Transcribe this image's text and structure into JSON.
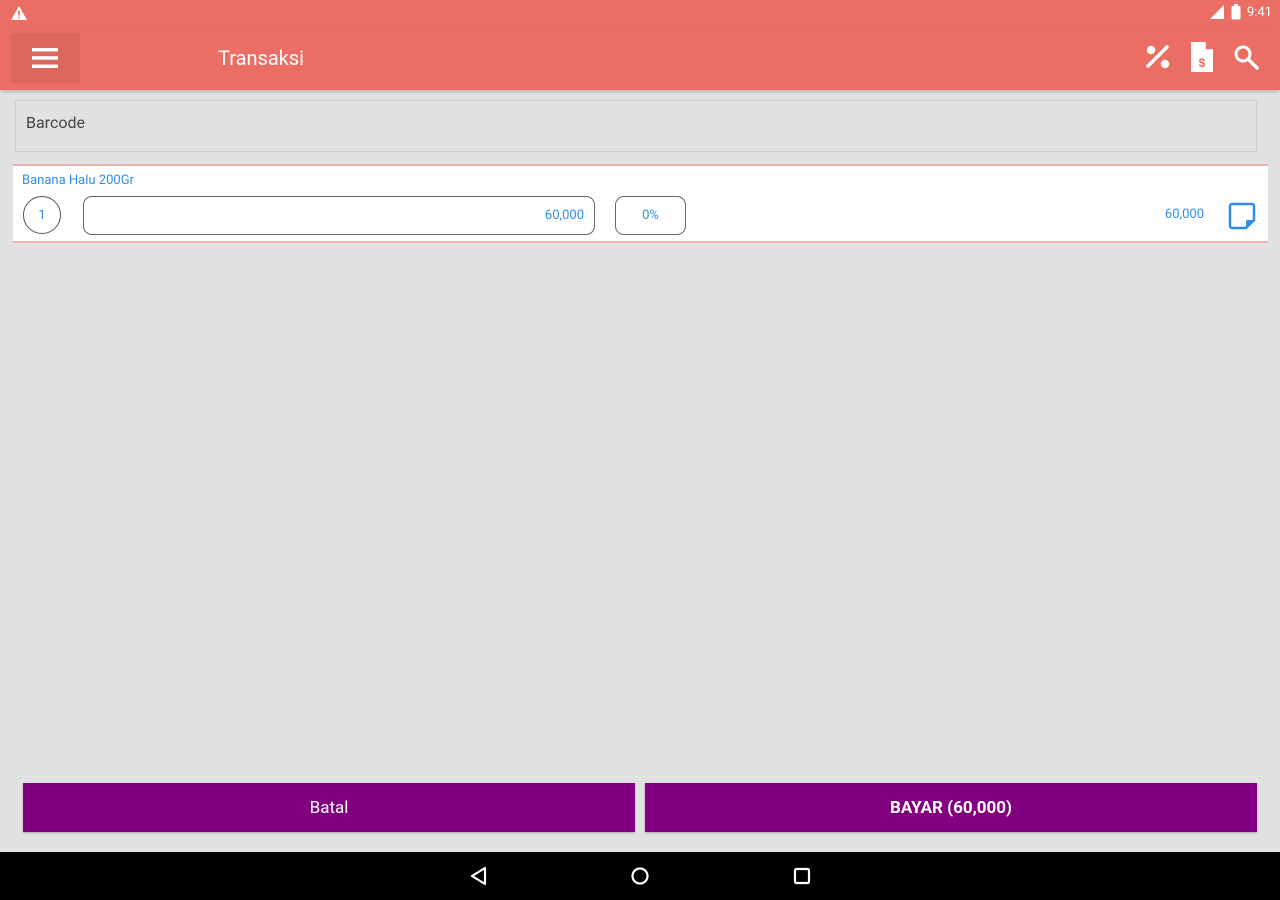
{
  "status_bar": {
    "time": "9:41",
    "icons": [
      "warning-icon",
      "signal-icon",
      "battery-icon"
    ]
  },
  "app_bar": {
    "title": "Transaksi",
    "icons": [
      "menu-icon",
      "discount-icon",
      "invoice-icon",
      "search-icon"
    ]
  },
  "barcode": {
    "placeholder": "Barcode",
    "value": ""
  },
  "items": [
    {
      "name": "Banana Halu 200Gr",
      "qty": "1",
      "price": "60,000",
      "discount": "0%",
      "subtotal": "60,000",
      "note_icon": "note-edit-icon"
    }
  ],
  "buttons": {
    "cancel": "Batal",
    "pay": "BAYAR (60,000)"
  },
  "nav_bar": {
    "icons": [
      "back-icon",
      "home-icon",
      "recents-icon"
    ]
  },
  "colors": {
    "header": "#ea6e64",
    "accent_text": "#2f8fe8",
    "button": "#800080",
    "background": "#e2e2e2"
  }
}
